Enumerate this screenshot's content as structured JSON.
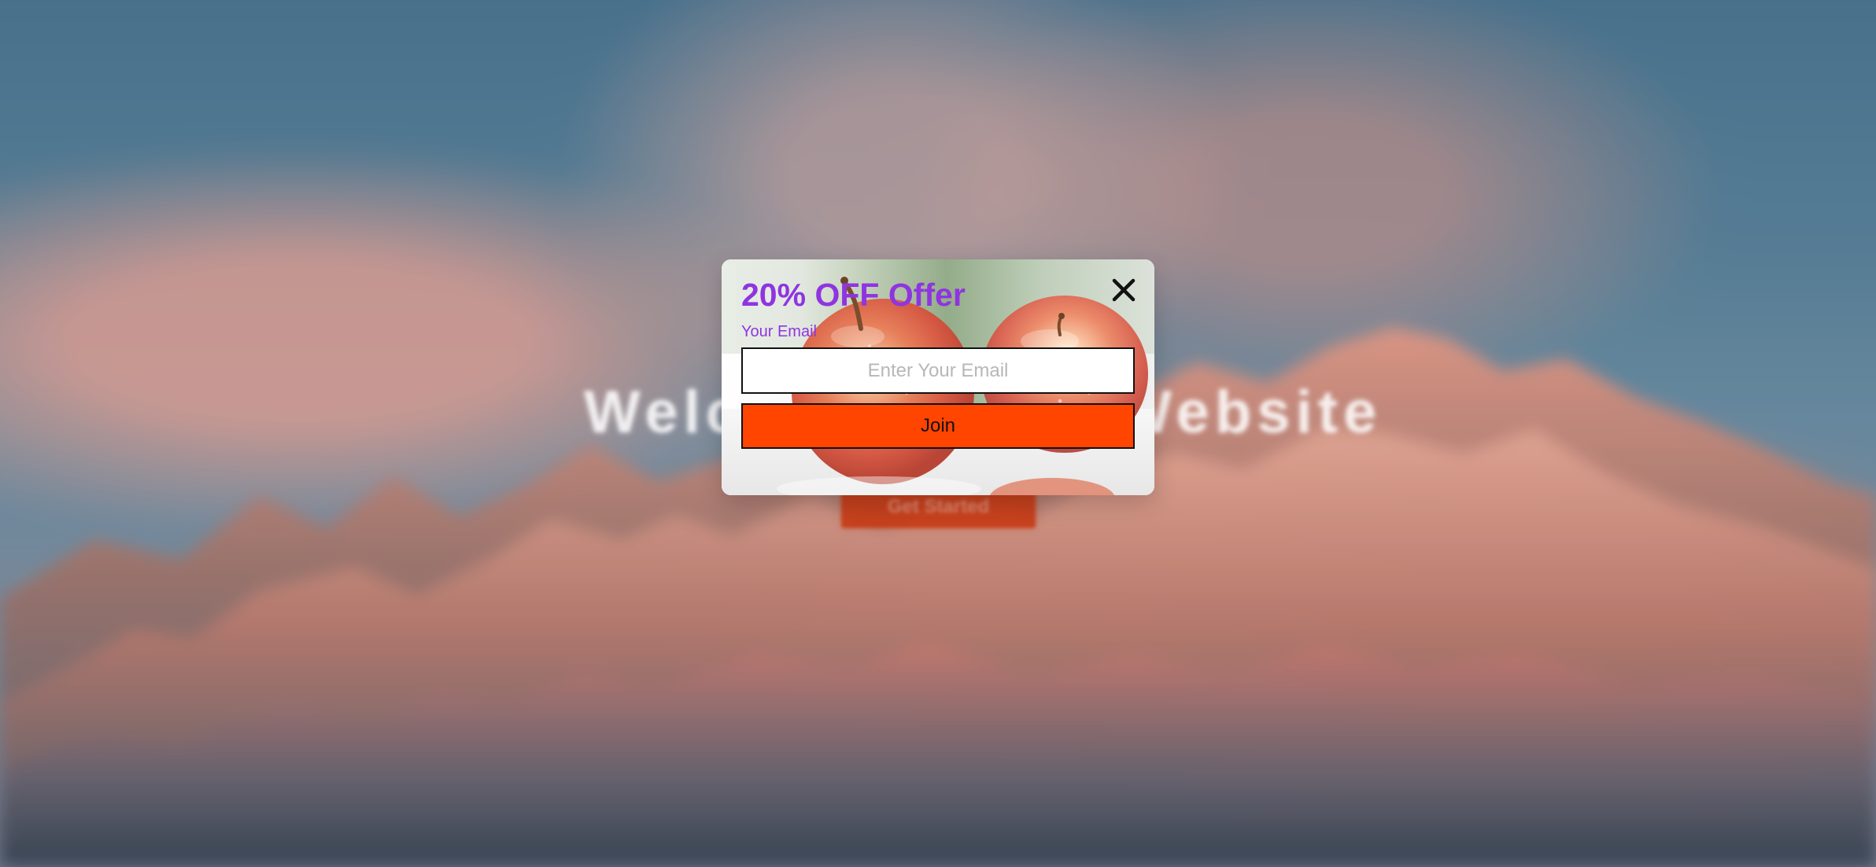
{
  "background": {
    "headline": "Welcome to my Website",
    "primary_button_label": "Get Started"
  },
  "popup": {
    "title": "20% OFF Offer",
    "email_label": "Your Email",
    "email_value": "",
    "email_placeholder": "Enter Your Email",
    "join_label": "Join",
    "close_icon": "close-icon"
  },
  "colors": {
    "accent": "#8f35e0",
    "button": "#ff4500",
    "background_sky": "#58819a"
  }
}
